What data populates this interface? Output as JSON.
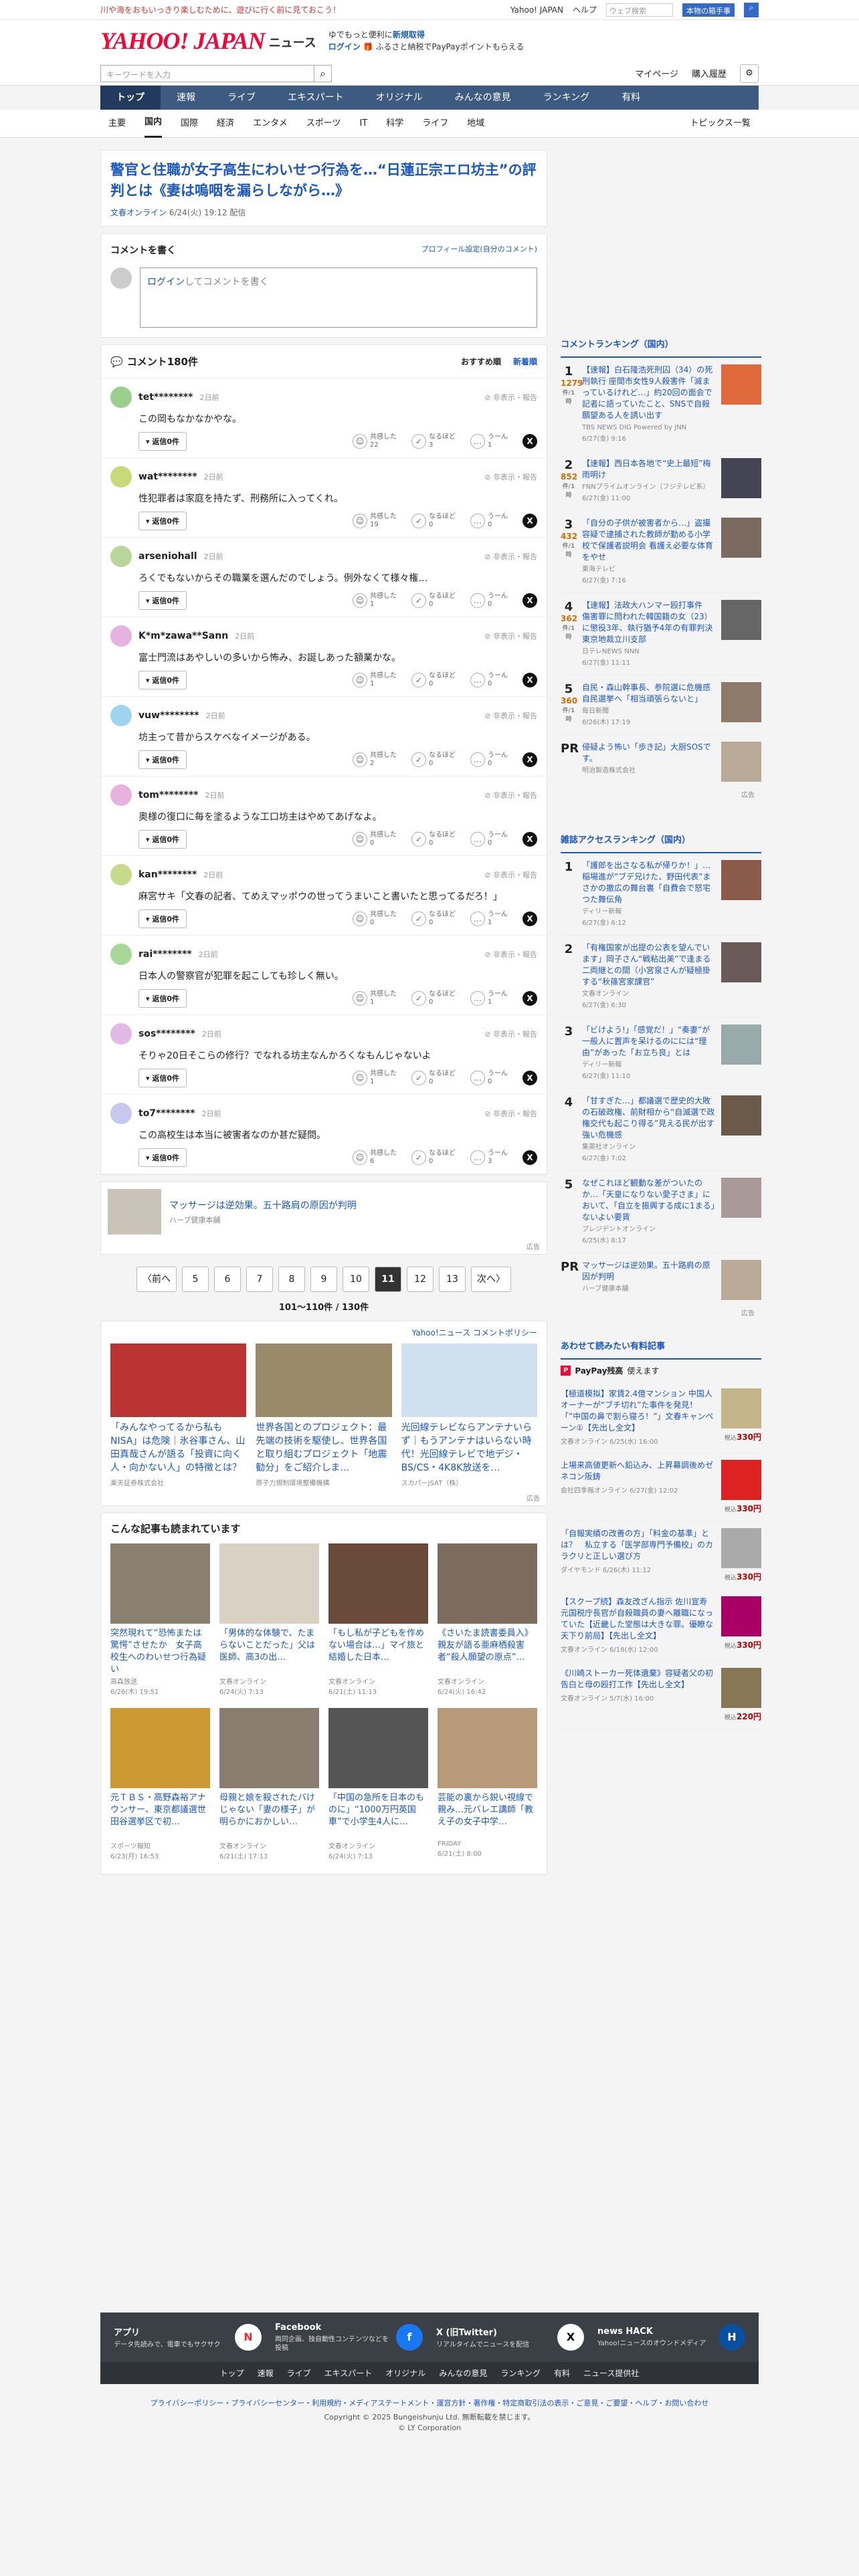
{
  "topbar": {
    "promo": "川や海をおもいっきり楽しむために、遊びに行く前に見ておこう！",
    "links": [
      "Yahoo! JAPAN",
      "ヘルプ"
    ],
    "search_placeholder": "ウェブ検索",
    "search_button": "本物の箱手事"
  },
  "header": {
    "logo": "YAHOO! JAPAN",
    "service": "ニュース",
    "promo1": "ゆでもっと便利に",
    "promo1b": "新規取得",
    "promo2": "ログイン",
    "promo2b": "ふるさと納税でPayPayポイントもらえる"
  },
  "search": {
    "placeholder": "キーワードを入力",
    "mypage": "マイページ",
    "purchased": "購入履歴"
  },
  "nav": [
    {
      "label": "トップ"
    },
    {
      "label": "速報"
    },
    {
      "label": "ライブ"
    },
    {
      "label": "エキスパート"
    },
    {
      "label": "オリジナル"
    },
    {
      "label": "みんなの意見"
    },
    {
      "label": "ランキング"
    },
    {
      "label": "有料"
    }
  ],
  "subnav": [
    {
      "label": "主要"
    },
    {
      "label": "国内"
    },
    {
      "label": "国際"
    },
    {
      "label": "経済"
    },
    {
      "label": "エンタメ"
    },
    {
      "label": "スポーツ"
    },
    {
      "label": "IT"
    },
    {
      "label": "科学"
    },
    {
      "label": "ライフ"
    },
    {
      "label": "地域"
    }
  ],
  "subnav_topics": "トピックス一覧",
  "article": {
    "title": "警官と住職が女子高生にわいせつ行為を…“日蓮正宗エロ坊主”の評判とは《妻は嗚咽を漏らしながら…》",
    "source": "文春オンライン",
    "date": "6/24(火) 19:12 配信"
  },
  "comment_form": {
    "title": "コメントを書く",
    "profile": "プロフィール設定(自分のコメント)",
    "login": "ログイン",
    "placeholder": "してコメントを書く"
  },
  "comments_header": {
    "title": "コメント180件",
    "sort_rec": "おすすめ順",
    "sort_new": "新着順"
  },
  "reply_label": "返信0件",
  "report": "非表示・報告",
  "reaction_labels": [
    "共感した",
    "なるほど",
    "うーん"
  ],
  "comments": [
    {
      "name": "tet********",
      "time": "2日前",
      "text": "この岡もなかなかやな。",
      "r": [
        "22",
        "3",
        "1"
      ],
      "color": "#9ccf8e"
    },
    {
      "name": "wat********",
      "time": "2日前",
      "text": "性犯罪者は家庭を持たず、刑務所に入ってくれ。",
      "r": [
        "19",
        "0",
        "0"
      ],
      "color": "#c8d97a"
    },
    {
      "name": "arseniohall",
      "time": "2日前",
      "text": "ろくでもないからその職業を選んだのでしょう。例外なくて様々権…",
      "r": [
        "1",
        "0",
        "0"
      ],
      "color": "#b9d69a"
    },
    {
      "name": "K*m*zawa**Sann",
      "time": "2日前",
      "text": "富士門流はあやしいの多いから怖み、お誕しあった額業かな。",
      "r": [
        "1",
        "0",
        "0"
      ],
      "color": "#e6b3e0"
    },
    {
      "name": "vuw********",
      "time": "2日前",
      "text": "坊主って昔からスケベなイメージがある。",
      "r": [
        "2",
        "0",
        "0"
      ],
      "color": "#9fd4ef"
    },
    {
      "name": "tom********",
      "time": "2日前",
      "text": "奥様の復口に毎を塗るような工口坊主はやめてあげなよ。",
      "r": [
        "0",
        "0",
        "0"
      ],
      "color": "#e8b2e0"
    },
    {
      "name": "kan********",
      "time": "2日前",
      "text": "麻宮サキ「文春の記者、てめえマッポウの世ってうまいこと書いたと思ってるだろ！」",
      "r": [
        "0",
        "0",
        "1"
      ],
      "color": "#c7d98a"
    },
    {
      "name": "rai********",
      "time": "2日前",
      "text": "日本人の警察官が犯罪を起こしても珍しく無い。",
      "r": [
        "1",
        "0",
        "1"
      ],
      "color": "#a7d89a"
    },
    {
      "name": "sos********",
      "time": "2日前",
      "text": "そりゃ20日そこらの修行？でなれる坊主なんかろくなもんじゃないよ",
      "r": [
        "1",
        "0",
        "0"
      ],
      "color": "#e2b8e6"
    },
    {
      "name": "to7********",
      "time": "2日前",
      "text": "この高校生は本当に被害者なのか甚だ疑問。",
      "r": [
        "6",
        "0",
        "3"
      ],
      "color": "#c8c8ef"
    }
  ],
  "ad_inline": {
    "title": "マッサージは逆効果。五十路肩の原因が判明",
    "sponsor": "ハーブ健康本舗",
    "label": "広告"
  },
  "pager": {
    "prev": "〈前へ",
    "next": "次へ〉",
    "pages": [
      "5",
      "6",
      "7",
      "8",
      "9",
      "10",
      "11",
      "12",
      "13"
    ],
    "current": "11",
    "count": "101～110件 / 130件"
  },
  "policy": "Yahoo!ニュース コメントポリシー",
  "ads3": [
    {
      "title": "「みんなやってるから私もNISA」は危険｜氷谷事さん、山田真哉さんが語る「投資に向く人・向かない人」の特徴とは？",
      "sponsor": "楽天証券株式会社",
      "bg": "#b33"
    },
    {
      "title": "世界各国とのプロジェクト：最先端の技術を駆使し、世界各国と取り組むプロジェクト「地震勧分」をご紹介しま…",
      "sponsor": "原子力規制環境整備機構",
      "bg": "#9a8a6a"
    },
    {
      "title": "光回線テレビならアンテナいらず｜もうアンテナはいらない時代！光回線テレビで地デジ・BS/CS・4K8K放送を…",
      "sponsor": "スカパーJSAT（株）",
      "bg": "#cfe1ee"
    }
  ],
  "ads_label": "広告",
  "also": {
    "title": "こんな記事も読まれています",
    "items": [
      {
        "title": "突然現れて“恐怖または驚愕”させたか　女子高校生へのわいせつ行為疑い",
        "source": "高森放送",
        "date": "6/26(木) 19:51",
        "bg": "#8a8070"
      },
      {
        "title": "「男体的な体験で、たまらないことだった」父は医師、高3の出…",
        "source": "文春オンライン",
        "date": "6/24(火) 7:13",
        "bg": "#d9d2c4"
      },
      {
        "title": "「もし私が子どもを作めない場合は…」マイ旅と結婚した日本…",
        "source": "文春オンライン",
        "date": "6/21(土) 11:13",
        "bg": "#6a4a3a"
      },
      {
        "title": "《さいたま読書委員入》親友が語る亜麻栖殺害者“殺人願望の原点”…",
        "source": "文春オンライン",
        "date": "6/24(火) 16:42",
        "bg": "#7d6b5d"
      },
      {
        "title": "元ＴＢＳ・高野森裕アナウンサー、東京都議選世田谷選挙区で初…",
        "source": "スポーツ報知",
        "date": "6/23(月) 16:53",
        "bg": "#c93"
      },
      {
        "title": "母親と娘を殺されたバけじゃない「妻の様子」が明らかにおかしい…",
        "source": "文春オンライン",
        "date": "6/21(土) 17:13",
        "bg": "#8b7d70"
      },
      {
        "title": "「中国の急所を日本のものに」“1000万円英国車”で小学生4人に…",
        "source": "文春オンライン",
        "date": "6/24(火) 7:13",
        "bg": "#555"
      },
      {
        "title": "芸能の裏から鋭い視線で親み…元バレエ講師「教え子の女子中学…",
        "source": "FRIDAY",
        "date": "6/21(土) 8:00",
        "bg": "#b89a7a"
      }
    ]
  },
  "ranking": {
    "title": "コメントランキング（国内）",
    "items": [
      {
        "no": "1",
        "count": "1279",
        "unit": "件/1時",
        "title": "【速報】白石隆浩死刑囚（34）の死刑執行 座間市女性9人殺害件「滅まっているけれど…」約20回の面会で記者に語っていたこと、SNSで自殺願望ある人を誘い出す",
        "source": "TBS NEWS DIG Powered by JNN",
        "date": "6/27(金) 9:16",
        "bg": "#e06a3b"
      },
      {
        "no": "2",
        "count": "852",
        "unit": "件/1時",
        "title": "【速報】西日本各地で“史上最短”梅雨明け",
        "source": "FNNプライムオンライン（フジテレビ系）",
        "date": "6/27(金) 11:00",
        "bg": "#445"
      },
      {
        "no": "3",
        "count": "432",
        "unit": "件/1時",
        "title": "「自分の子供が被害者から…」盗撮容疑で逮捕された教師が勤める小学校で保護者説明会 看護え必要な体育をやせ",
        "source": "東海テレビ",
        "date": "6/27(金) 7:16",
        "bg": "#7a6a60"
      },
      {
        "no": "4",
        "count": "362",
        "unit": "件/1時",
        "title": "【速報】法政大ハンマー殴打事件　傷害罪に問われた韓国籍の女（23）に懲役3年、執行猶予4年の有罪判決　東京地裁立川支部",
        "source": "日テレNEWS NNN",
        "date": "6/27(金) 11:11",
        "bg": "#666"
      },
      {
        "no": "5",
        "count": "360",
        "unit": "件/1時",
        "title": "自民・森山幹事長、参院選に危機感　自民選挙へ「相当頑張らないと」",
        "source": "毎日新聞",
        "date": "6/26(木) 17:19",
        "bg": "#8d7a6a"
      }
    ],
    "pr": {
      "title": "侵疑よう怖い「歩き記」大厨SOSです。",
      "source": "明治製造株式会社"
    },
    "ad_label": "広告"
  },
  "access": {
    "title": "雑誌アクセスランキング（国内）",
    "items": [
      {
        "no": "1",
        "title": "「護郎を出さなる私が帰りか！」…稲場進が“ブデ兄けた、野田代表”まさかの撤広の舞台裏「自費会で怒宅つた舞伝角",
        "source": "ディリー新報",
        "date": "6/27(金) 6:12",
        "bg": "#8a5a4a"
      },
      {
        "no": "2",
        "title": "「有権国家が出提の公表を望んでいます」岡子さん“戦粘出美”で逢まる二両継との間（小宮泉さんが疑極掛する“秋篠宮家課官”",
        "source": "文春オンライン",
        "date": "6/27(金) 6:30",
        "bg": "#6a5a5a"
      },
      {
        "no": "3",
        "title": "「ビけよう!」「感覚だ！」“奏妻”が一般人に置声を呆けるのにには“理由”があった「お立ち良」とは",
        "source": "ディリー新報",
        "date": "6/27(金) 11:10",
        "bg": "#9aa"
      },
      {
        "no": "4",
        "title": "「甘すぎた…」都議選で歴史的大敗の石破政権、前財相から“自滅選で政権交代も起こり得る”見える民が出す強い危機感",
        "source": "集英社オンライン",
        "date": "6/27(金) 7:02",
        "bg": "#6b5a4a"
      },
      {
        "no": "5",
        "title": "なぜこれほど観動な差がついたのか…「天皇になりない愛子さま」において、「自立を振興する成に1まる」ないよい要貨",
        "source": "プレジデントオンライン",
        "date": "6/25(水) 8:17",
        "bg": "#a99"
      }
    ],
    "pr": {
      "title": "マッサージは逆効果。五十路肩の原因が判明",
      "source": "ハーブ健康本舗"
    },
    "ad_label": "広告"
  },
  "books": {
    "title": "あわせて読みたい有料記事",
    "pay_label": "PayPay残高",
    "pay_text": "使えます",
    "items": [
      {
        "title": "【極道模拟】家賃2.4億マンション 中国人オーナーが“ブチ切れ”た事件を発見！「”中国の鼻で割ら寝ろ！”」文春キャンペーン①【先出し全文】",
        "source": "文春オンライン",
        "date": "6/25(水) 16:00",
        "price": "330",
        "bg": "#c4b48a"
      },
      {
        "title": "上場来高値更新へ鉛込み、上昇幕調後めゼネコン阪鋳",
        "source": "会社四季報オンライン",
        "date": "6/27(金) 12:02",
        "price": "330",
        "bg": "#d22"
      },
      {
        "title": "「自報実績の改善の方」「料金の基準」とは？　私立する「医学部専門予備校」のカラクリと正しい選び方",
        "source": "ダイヤモンド",
        "date": "6/26(木) 11:12",
        "price": "330",
        "bg": "#aaa"
      },
      {
        "title": "【スクープ続】森友改ざん指示 佐川宣寿元国税庁長官が自殺職員の妻へ離職になっていた【近畿した堂態は大きな罪。優瞭な天下り前局】【先出し全文】",
        "source": "文春オンライン",
        "date": "6/18(水) 12:00",
        "price": "330",
        "bg": "#a06"
      },
      {
        "title": "《川崎ストーカー死体遺棄》容疑者父の初告白と母の殴打工作【先出し全文】",
        "source": "文春オンライン",
        "date": "5/7(水) 16:00",
        "price": "220",
        "bg": "#875"
      }
    ],
    "price_prefix": "税込",
    "price_suffix": "円"
  },
  "footer_boxes": [
    {
      "title": "アプリ",
      "text": "データ先読みで、電車でもサクサク",
      "icon": "N",
      "bg": "#fff",
      "fg": "#d33"
    },
    {
      "title": "Facebook",
      "text": "両同企画、独自動性コンテンツなどを投稿",
      "icon": "f",
      "bg": "#1877f2",
      "fg": "#fff"
    },
    {
      "title": "X (旧Twitter)",
      "text": "リアルタイムでニュースを配信",
      "icon": "X",
      "bg": "#fff",
      "fg": "#000"
    },
    {
      "title": "news HACK",
      "text": "Yahoo!ニュースのオウンドメディア",
      "icon": "H",
      "bg": "#0a4fa0",
      "fg": "#fff"
    }
  ],
  "footer_links": [
    "トップ",
    "速報",
    "ライブ",
    "エキスパート",
    "オリジナル",
    "みんなの意見",
    "ランキング",
    "有料",
    "ニュース提供社"
  ],
  "footer_policy": "プライバシーポリシー・プライバシーセンター・利用規約・メディアステートメント・運営方針・著作権・特定商取引法の表示・ご意見・ご要望・ヘルプ・お問い合わせ",
  "copyright1": "Copyright © 2025 Bungeishunju Ltd. 無断転載を禁じます。",
  "copyright2": "© LY Corporation"
}
